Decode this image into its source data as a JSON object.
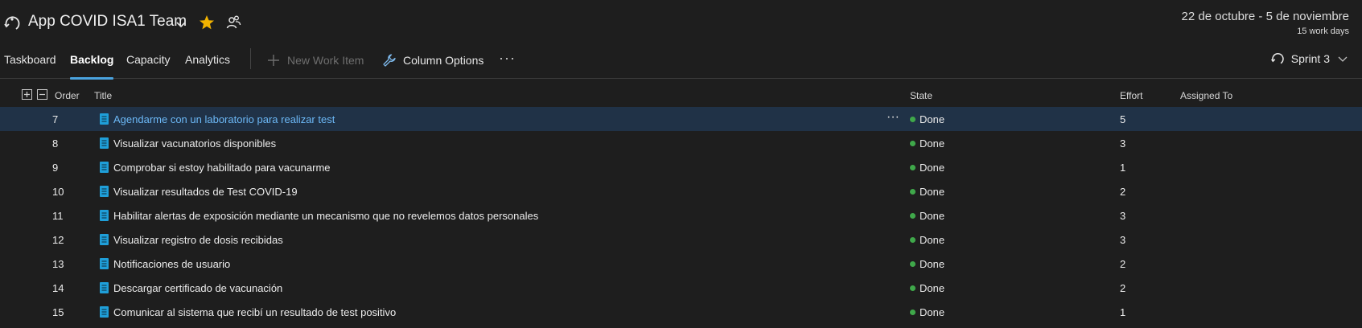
{
  "header": {
    "team_name": "App COVID ISA1 Team",
    "date_range": "22 de octubre - 5 de noviembre",
    "work_days": "15 work days"
  },
  "toolbar": {
    "tabs": [
      {
        "label": "Taskboard",
        "active": false
      },
      {
        "label": "Backlog",
        "active": true
      },
      {
        "label": "Capacity",
        "active": false
      },
      {
        "label": "Analytics",
        "active": false
      }
    ],
    "new_work_item_label": "New Work Item",
    "column_options_label": "Column Options",
    "more_label": "···",
    "sprint_label": "Sprint 3"
  },
  "grid": {
    "columns": {
      "order": "Order",
      "title": "Title",
      "state": "State",
      "effort": "Effort",
      "assigned_to": "Assigned To"
    },
    "rows": [
      {
        "order": "7",
        "title": "Agendarme con un laboratorio para realizar test",
        "state": "Done",
        "effort": "5",
        "selected": true
      },
      {
        "order": "8",
        "title": "Visualizar vacunatorios disponibles",
        "state": "Done",
        "effort": "3"
      },
      {
        "order": "9",
        "title": "Comprobar si estoy habilitado para vacunarme",
        "state": "Done",
        "effort": "1"
      },
      {
        "order": "10",
        "title": "Visualizar resultados de Test COVID-19",
        "state": "Done",
        "effort": "2"
      },
      {
        "order": "11",
        "title": "Habilitar alertas de exposición mediante un mecanismo que no revelemos datos personales",
        "state": "Done",
        "effort": "3"
      },
      {
        "order": "12",
        "title": "Visualizar registro de dosis recibidas",
        "state": "Done",
        "effort": "3"
      },
      {
        "order": "13",
        "title": "Notificaciones de usuario",
        "state": "Done",
        "effort": "2"
      },
      {
        "order": "14",
        "title": "Descargar certificado de vacunación",
        "state": "Done",
        "effort": "2"
      },
      {
        "order": "15",
        "title": "Comunicar al sistema que recibí un resultado de test positivo",
        "state": "Done",
        "effort": "1"
      }
    ]
  },
  "colors": {
    "background": "#1e1e1e",
    "accent": "#4aa3df",
    "selected_row": "#203247",
    "done_dot": "#3fa84a",
    "work_item_icon": "#1f9fd9",
    "star": "#f2b300"
  },
  "icons": [
    "sprint-icon",
    "chevron-down-icon",
    "star-icon",
    "team-members-icon",
    "plus-icon",
    "wrench-icon",
    "more-icon",
    "expand-all-icon",
    "collapse-all-icon",
    "backlog-item-icon"
  ]
}
